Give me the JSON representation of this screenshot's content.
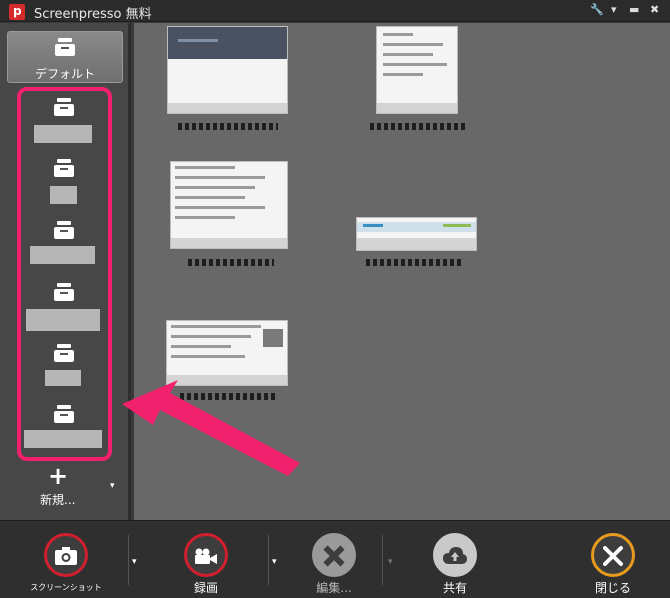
{
  "window": {
    "title": "Screenpresso 無料",
    "logo_letter": "p",
    "controls": {
      "wrench": "🔧",
      "menu": "▾",
      "minimize": "▬",
      "close": "✖"
    }
  },
  "sidebar": {
    "default_folder_label": "デフォルト",
    "new_label": "新規...",
    "new_plus": "+",
    "dropdown_glyph": "▾",
    "highlight_color": "#f2216d"
  },
  "toolbar": {
    "screenshot_label": "スクリーンショット",
    "record_label": "録画",
    "edit_label": "編集...",
    "share_label": "共有",
    "close_label": "閉じる",
    "dropdown_glyph": "▾"
  },
  "colors": {
    "accent_red": "#d0202e",
    "close_orange": "#e89a1c",
    "arrow_pink": "#f2216d"
  }
}
